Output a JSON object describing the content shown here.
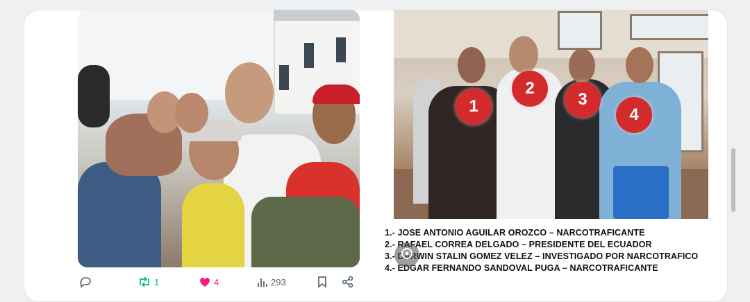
{
  "post": {
    "right_image": {
      "markers": [
        "1",
        "2",
        "3",
        "4"
      ],
      "caption_lines": [
        "1.- JOSE ANTONIO AGUILAR OROZCO – NARCOTRAFICANTE",
        "2.- RAFAEL CORREA DELGADO – PRESIDENTE DEL ECUADOR",
        "3.- DARWIN STALIN GOMEZ VELEZ – INVESTIGADO POR NARCOTRAFICO",
        "4.- EDGAR FERNANDO SANDOVAL PUGA – NARCOTRAFICANTE"
      ]
    },
    "actions": {
      "reply_icon": "reply-icon",
      "retweet_icon": "retweet-icon",
      "retweet_count": "1",
      "like_icon": "heart-icon",
      "like_count": "4",
      "views_icon": "views-icon",
      "views_count": "293",
      "bookmark_icon": "bookmark-icon",
      "share_icon": "share-icon"
    },
    "colors": {
      "retweet_active": "#00ba7c",
      "like_active": "#f91880",
      "marker": "#d32b2b",
      "icon_default": "#536471"
    }
  }
}
